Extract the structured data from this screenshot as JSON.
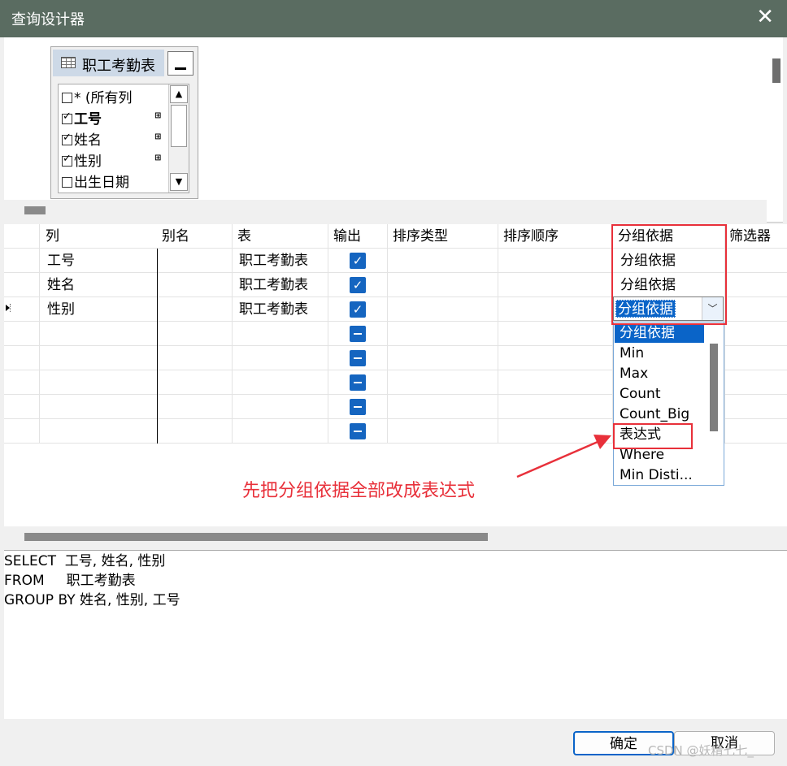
{
  "window": {
    "title": "查询设计器",
    "close_glyph": "✕"
  },
  "diagram": {
    "table_name": "职工考勤表",
    "fields": [
      {
        "label": "* (所有列",
        "checked": false,
        "bold": false,
        "key": ""
      },
      {
        "label": "工号",
        "checked": true,
        "bold": true,
        "key": "⊞"
      },
      {
        "label": "姓名",
        "checked": true,
        "bold": false,
        "key": "⊞"
      },
      {
        "label": "性别",
        "checked": true,
        "bold": false,
        "key": "⊞"
      },
      {
        "label": "出生日期",
        "checked": false,
        "bold": false,
        "key": ""
      }
    ]
  },
  "grid": {
    "headers": [
      "列",
      "别名",
      "表",
      "输出",
      "排序类型",
      "排序顺序",
      "分组依据",
      "筛选器"
    ],
    "rows": [
      {
        "column": "工号",
        "table": "职工考勤表",
        "group_by": "分组依据"
      },
      {
        "column": "姓名",
        "table": "职工考勤表",
        "group_by": "分组依据"
      },
      {
        "column": "性别",
        "table": "职工考勤表",
        "group_by": "分组依据"
      }
    ],
    "combo_value": "分组依据",
    "combo_arrow": "﹀"
  },
  "dropdown": {
    "options": [
      "分组依据",
      "Min",
      "Max",
      "Count",
      "Count_Big",
      "表达式",
      "Where",
      "Min Disti..."
    ],
    "highlighted_index": 0
  },
  "annotation": {
    "text": "先把分组依据全部改成表达式",
    "color": "#e8303a"
  },
  "sql": {
    "lines": [
      "SELECT  工号, 姓名, 性别",
      "FROM     职工考勤表",
      "GROUP BY 姓名, 性别, 工号"
    ]
  },
  "buttons": {
    "ok": "确定",
    "cancel": "取消"
  },
  "watermark": "CSDN @妖精七七_",
  "colors": {
    "titlebar": "#5a6c61",
    "accent": "#0a64c8",
    "highlight_red": "#e8303a"
  }
}
